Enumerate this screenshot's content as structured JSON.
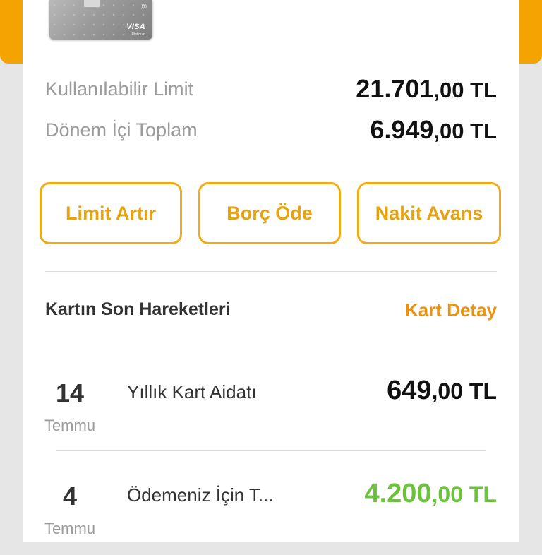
{
  "colors": {
    "accent": "#f5a300",
    "button_border": "#f0ab15",
    "link": "#e8920f",
    "positive": "#6cc23c"
  },
  "card": {
    "brand": "VISA",
    "tier": "Platinum",
    "icon": "contactless-icon"
  },
  "summary": {
    "available_limit_label": "Kullanılabilir Limit",
    "available_limit_int": "21.701",
    "available_limit_dec": ",00 TL",
    "period_total_label": "Dönem İçi Toplam",
    "period_total_int": "6.949",
    "period_total_dec": ",00 TL"
  },
  "actions": {
    "limit_increase": "Limit Artır",
    "pay_debt": "Borç Öde",
    "cash_advance": "Nakit Avans"
  },
  "transactions_section": {
    "title": "Kartın Son Hareketleri",
    "detail_link": "Kart Detay",
    "items": [
      {
        "day": "14",
        "month": "Temmu",
        "description": "Yıllık Kart Aidatı",
        "amount_int": "649",
        "amount_dec": ",00 TL"
      },
      {
        "day": "4",
        "month": "Temmu",
        "description": "Ödemeniz İçin T...",
        "amount_int": "4.200",
        "amount_dec": ",00 TL"
      }
    ]
  }
}
